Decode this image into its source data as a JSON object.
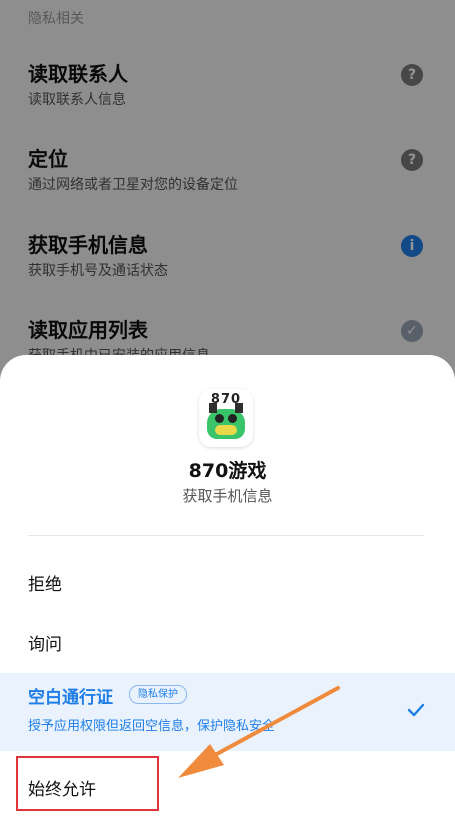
{
  "background": {
    "section_title": "隐私相关",
    "items": [
      {
        "title": "读取联系人",
        "subtitle": "读取联系人信息",
        "icon": "help-icon"
      },
      {
        "title": "定位",
        "subtitle": "通过网络或者卫星对您的设备定位",
        "icon": "help-icon"
      },
      {
        "title": "获取手机信息",
        "subtitle": "获取手机号及通话状态",
        "icon": "info-icon"
      },
      {
        "title": "读取应用列表",
        "subtitle": "获取手机中已安装的应用信息",
        "icon": "shield-icon"
      }
    ]
  },
  "sheet": {
    "app_icon_text": "870",
    "app_name": "870游戏",
    "request": "获取手机信息",
    "options": {
      "deny": "拒绝",
      "ask": "询问",
      "blank_pass": {
        "title": "空白通行证",
        "badge": "隐私保护",
        "subtitle": "授予应用权限但返回空信息，保护隐私安全"
      },
      "always_allow": "始终允许"
    }
  },
  "colors": {
    "accent": "#1f7ee8",
    "highlight": "#e0353b",
    "arrow": "#f08a3c"
  }
}
